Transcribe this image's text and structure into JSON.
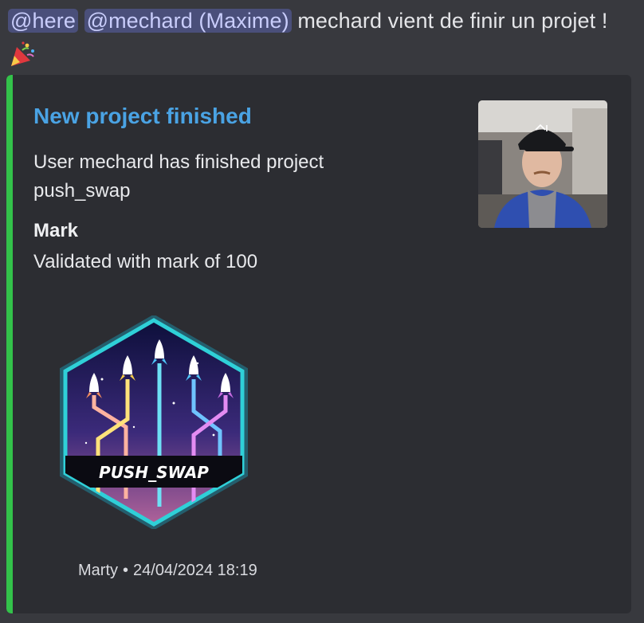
{
  "message": {
    "mention_here": "@here",
    "mention_user": "@mechard (Maxime)",
    "text": " mechard vient de finir un projet !",
    "emoji": "party-popper-icon"
  },
  "embed": {
    "accent_color": "#33c24a",
    "title": "New project finished",
    "description_line1": "User mechard has finished project",
    "description_line2": "push_swap",
    "field_name": "Mark",
    "field_value": "Validated with mark of 100",
    "badge_label": "PUSH_SWAP",
    "footer_author": "Marty",
    "footer_separator": "•",
    "footer_timestamp": "24/04/2024 18:19"
  }
}
